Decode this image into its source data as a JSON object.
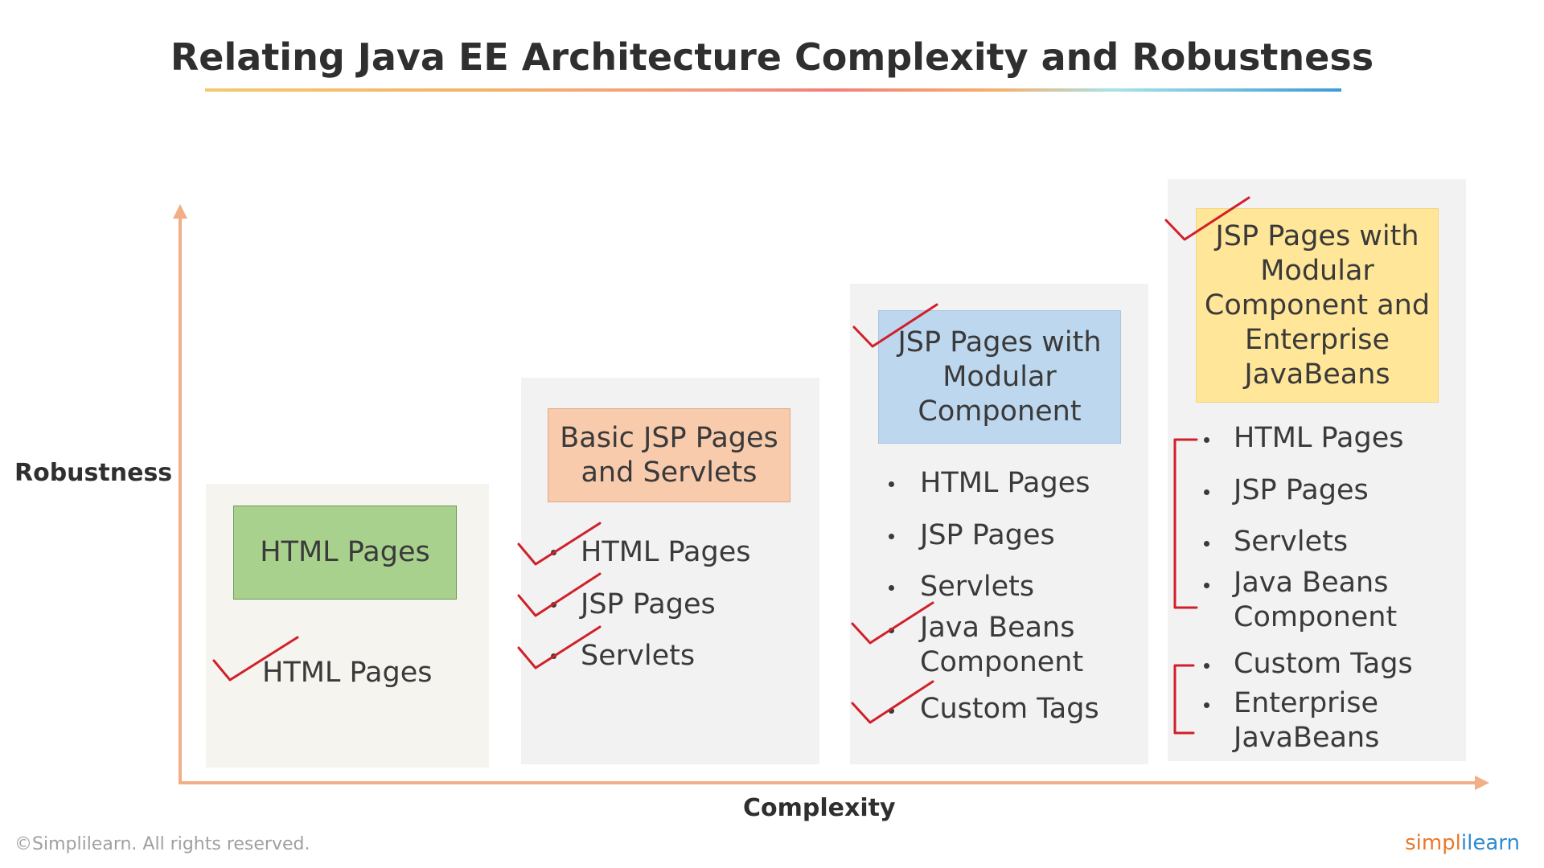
{
  "title": "Relating Java EE Architecture Complexity and Robustness",
  "axes": {
    "y_label": "Robustness",
    "x_label": "Complexity"
  },
  "stages": [
    {
      "header": "HTML Pages",
      "header_color": "#a9d18e",
      "items": [
        "HTML Pages"
      ]
    },
    {
      "header": "Basic JSP Pages and Servlets",
      "header_color": "#f8cbad",
      "items": [
        "HTML Pages",
        "JSP Pages",
        "Servlets"
      ]
    },
    {
      "header": "JSP Pages with Modular Component",
      "header_color": "#bdd7ee",
      "items": [
        "HTML Pages",
        "JSP Pages",
        "Servlets",
        "Java Beans Component",
        "Custom Tags"
      ]
    },
    {
      "header": "JSP Pages with Modular Component and Enterprise JavaBeans",
      "header_color": "#ffe699",
      "items": [
        "HTML Pages",
        "JSP Pages",
        "Servlets",
        "Java Beans Component",
        "Custom Tags",
        "Enterprise JavaBeans"
      ]
    }
  ],
  "footer": {
    "copyright": "©Simplilearn. All rights reserved.",
    "logo_part1": "simpl",
    "logo_part2": "ilearn"
  },
  "colors": {
    "axis": "#f2ae86",
    "annotation": "#d0202a"
  }
}
